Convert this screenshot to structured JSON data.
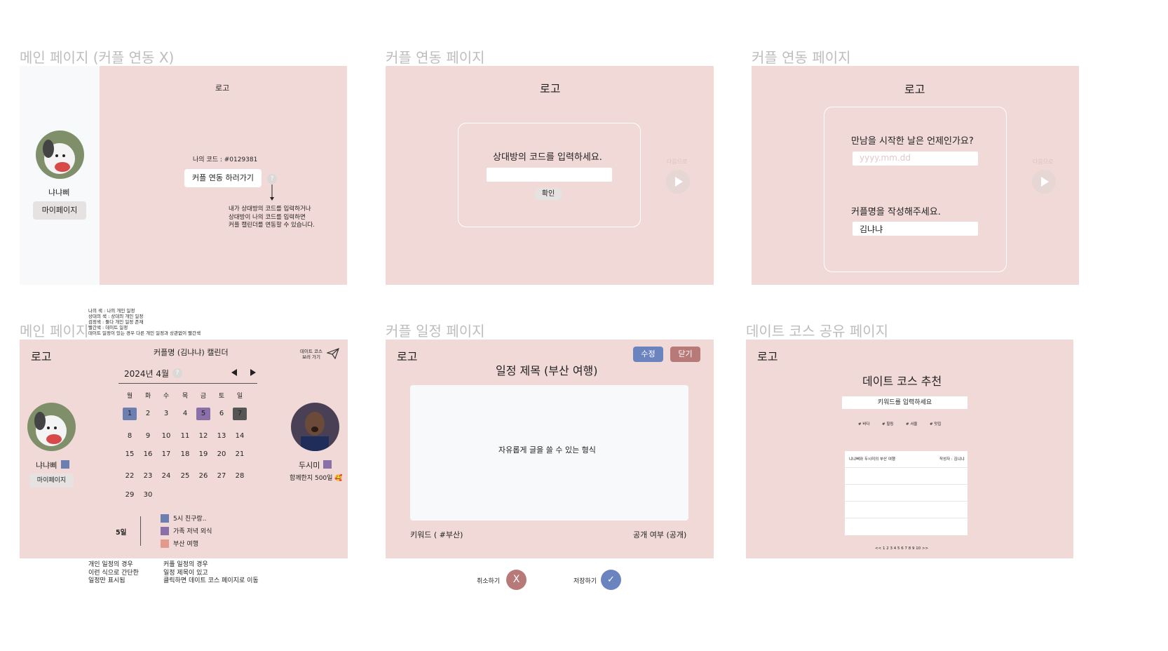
{
  "colors": {
    "panel": "#f0d9d6",
    "sidebar": "#f8f9fb",
    "blue": "#6b7fb0",
    "purple": "#8b6fa8",
    "dark": "#555555",
    "salmon": "#e39a8c",
    "edit": "#6b84c0",
    "close": "#b87a78"
  },
  "screen1": {
    "section_title": "메인 페이지 (커플 연동 X)",
    "logo": "로고",
    "user_name": "냐냐삐",
    "mypage_button": "마이페이지",
    "my_code": "나의 코드 : #0129381",
    "link_button": "커플 연동 하러가기",
    "help": "?",
    "note": "내가 상대방의 코드를 입력하거나\n상대방이 나의 코드를 입력하면\n커플 캘린더를 연동할 수 있습니다."
  },
  "screen2": {
    "section_title": "커플 연동 페이지",
    "logo": "로고",
    "prompt": "상대방의 코드를 입력하세요.",
    "confirm_button": "확인",
    "next_label": "다음으로"
  },
  "screen3": {
    "section_title": "커플 연동 페이지",
    "logo": "로고",
    "date_question": "만남을 시작한 날은 언제인가요?",
    "date_placeholder": "yyyy.mm.dd",
    "name_question": "커플명을 작성해주세요.",
    "name_value": "김냐냐",
    "next_label": "다음으로"
  },
  "screen4": {
    "section_title": "메인 페이지",
    "legend_note": "나의 색 : 나의 개인 일정\n상대의 색 : 상대의 개인 일정\n검정색 : 둘다 개인 일정 존재\n빨간색 : 데이트 일정\n데이트 일정이 있는 경우 다른 개인 일정과 상관없이 빨간색",
    "logo": "로고",
    "calendar_title": "커플명 (김냐냐) 캘린더",
    "date_course_link": "데이트 코스\n보러 가기",
    "month": "2024년 4월",
    "help": "?",
    "weekdays": [
      "월",
      "화",
      "수",
      "목",
      "금",
      "토",
      "일"
    ],
    "days": [
      "1",
      "2",
      "3",
      "4",
      "5",
      "6",
      "7",
      "8",
      "9",
      "10",
      "11",
      "12",
      "13",
      "14",
      "15",
      "16",
      "17",
      "18",
      "19",
      "20",
      "21",
      "22",
      "23",
      "24",
      "25",
      "26",
      "27",
      "28",
      "29",
      "30"
    ],
    "user_name": "냐냐삐",
    "mypage_button": "마이페이지",
    "partner_name": "두시미",
    "together": "함께한지 500일 🥰",
    "selected_day": "5일",
    "events": [
      {
        "label": "5시 친구랑..",
        "color": "#6b7fb0"
      },
      {
        "label": "가족 저녁 외식",
        "color": "#8b6fa8"
      },
      {
        "label": "부산 여행",
        "color": "#e39a8c"
      }
    ],
    "note_personal": "개인 일정의 경우\n이런 식으로 간단한\n일정만 표시됨",
    "note_couple": "커플 일정의 경우\n일정 제목이 있고\n클릭하면 데이트 코스 페이지로 이동"
  },
  "screen5": {
    "section_title": "커플 일정 페이지",
    "logo": "로고",
    "edit_button": "수정",
    "close_button": "닫기",
    "schedule_title": "일정 제목 (부산 여행)",
    "free_text": "자유롭게 글을 쓸 수 있는 형식",
    "keyword": "키워드 ( #부산)",
    "visibility": "공개 여부 (공개)",
    "cancel_label": "취소하기",
    "cancel_icon": "X",
    "save_label": "저장하기",
    "save_icon": "✓"
  },
  "screen6": {
    "section_title": "데이트 코스 공유 페이지",
    "logo": "로고",
    "heading": "데이트 코스 추천",
    "search_placeholder": "키워드를 입력하세요",
    "tags": [
      "# 바다",
      "# 힐링",
      "# 서울",
      "# 맛집"
    ],
    "row_title": "냐냐삐와 두시미의 부산 여행",
    "row_author": "작성자 : 김냐냐",
    "pagination": "<< 1 2 3 4 5 6 7 8 9 10 >>"
  }
}
